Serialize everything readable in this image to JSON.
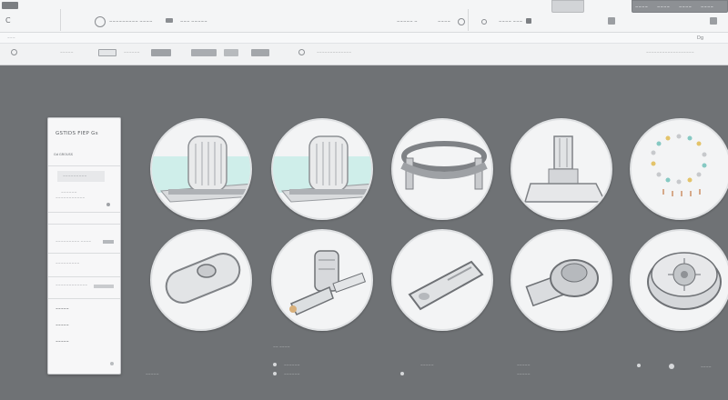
{
  "titlebar": {
    "left_glyph": "C",
    "app_text": "~~~~~~~~~ ~~~~",
    "nav_text": "~~~ ~~~~~",
    "right_text": "~~~~~ ~",
    "right_text2": "~~~~",
    "right_text3": "~~~~ ~~~",
    "right_box_labels": [
      "~~~~",
      "~~~~",
      "~~~~",
      "~~~~"
    ]
  },
  "address": {
    "left_text": "~~~",
    "right_text": "Dg"
  },
  "toolbar": {
    "items": [
      "~~~~~",
      "~~~~~~",
      "~~~~~~~~~~~~~",
      "~~~~~~~~~~~~~~~~~~"
    ]
  },
  "panel": {
    "title": "GSTIDS FIEP Gs",
    "sub1": "Gd GROUSS",
    "item_highlight": "~~~~~~~~~",
    "item_b": "~~~~~~",
    "item_c": "~~~~~~~~~~~",
    "item_d": "~~~~~~~~~ ~~~~",
    "item_e": "~~~~~~~~~",
    "item_f": "~~~~~~~~~~~~",
    "item_g": "~~~~~",
    "item_h": "~~~~~",
    "item_i": "~~~~~"
  },
  "tiles": [
    {
      "name": "bellows-capsule-fixture",
      "kind": "capsule"
    },
    {
      "name": "bellows-capsule-fixture-2",
      "kind": "capsule"
    },
    {
      "name": "clamp-ring-bracket",
      "kind": "clamp"
    },
    {
      "name": "vertical-nozzle-base",
      "kind": "nozzle"
    },
    {
      "name": "bead-ring-component",
      "kind": "ring"
    },
    {
      "name": "oval-button-plate",
      "kind": "plate"
    },
    {
      "name": "pipe-elbow-valve",
      "kind": "valve"
    },
    {
      "name": "angled-slider-bar",
      "kind": "slider"
    },
    {
      "name": "rotary-knob-block",
      "kind": "knob"
    },
    {
      "name": "gear-drum-motor",
      "kind": "drum"
    }
  ],
  "footer": {
    "under_panel": "~~ ~~~~",
    "labels": [
      "~~~~~",
      "~~~~~~",
      "~~~~~~",
      "~~~~~",
      "~~~~~",
      "~~~~~",
      "~~~~"
    ]
  },
  "colors": {
    "canvas": "#6f7275",
    "chrome": "#f4f5f6",
    "tile_face": "#f3f4f5",
    "accent_teal": "#bfe6e3"
  }
}
